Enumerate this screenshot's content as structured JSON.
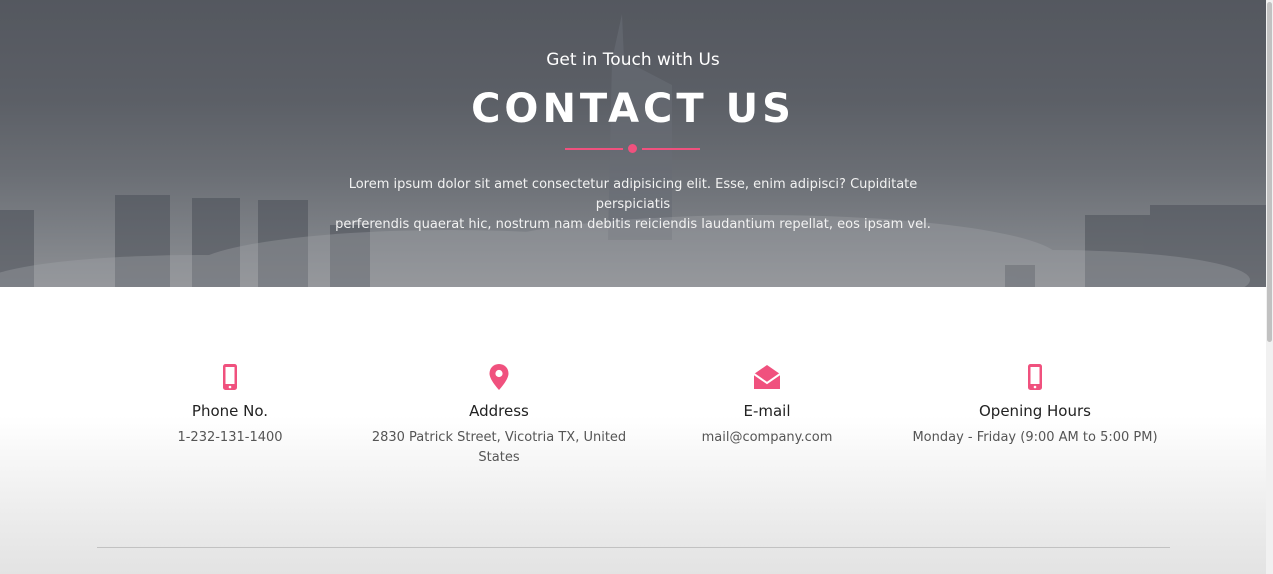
{
  "hero": {
    "subtitle": "Get in Touch with Us",
    "title": "CONTACT US",
    "description_line1": "Lorem ipsum dolor sit amet consectetur adipisicing elit. Esse, enim adipisci? Cupiditate perspiciatis",
    "description_line2": "perferendis quaerat hic, nostrum nam debitis reiciendis laudantium repellat, eos ipsam vel."
  },
  "contact": {
    "phone": {
      "title": "Phone No.",
      "value": "1-232-131-1400",
      "icon": "mobile-phone-icon"
    },
    "address": {
      "title": "Address",
      "value": "2830 Patrick Street, Vicotria TX, United States",
      "icon": "map-pin-icon"
    },
    "email": {
      "title": "E-mail",
      "value": "mail@company.com",
      "icon": "envelope-open-icon"
    },
    "hours": {
      "title": "Opening Hours",
      "value": "Monday - Friday (9:00 AM to 5:00 PM)",
      "icon": "mobile-phone-icon"
    }
  },
  "colors": {
    "accent": "#f0517e",
    "heading": "#222222",
    "text": "#555555"
  }
}
